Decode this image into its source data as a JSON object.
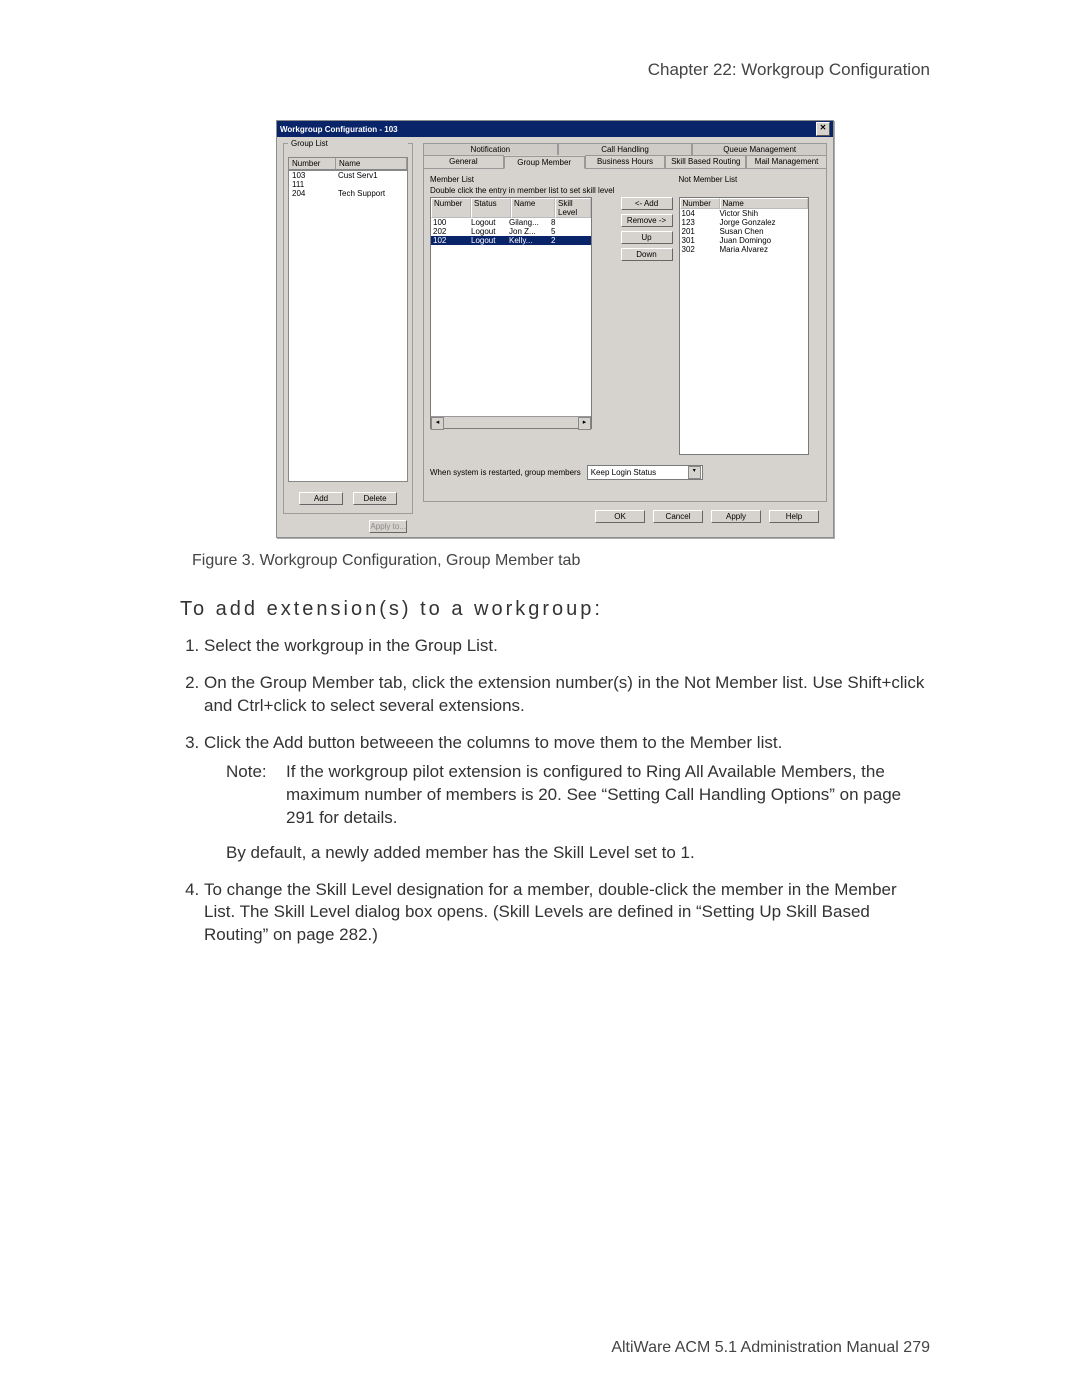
{
  "page": {
    "chapter_header": "Chapter 22:  Workgroup Configuration",
    "figure_caption": "Figure 3.   Workgroup Configuration, Group Member tab",
    "section_heading": "To add extension(s) to a workgroup:",
    "step1": "Select the workgroup in the Group List.",
    "step2": "On the Group Member tab, click the extension number(s) in the Not Member list. Use Shift+click and Ctrl+click to select several extensions.",
    "step3": "Click the Add button betweeen the columns to move them to the Member list.",
    "note_label": "Note:",
    "note_body": "If the workgroup pilot extension is configured to Ring All Available Members, the maximum number of members is 20. See “Setting Call Handling Options” on page 291 for details.",
    "default_line": "By default, a newly added member has the Skill Level set to 1.",
    "step4": "To change the Skill Level designation for a member, double-click the member in the Member List. The Skill Level dialog box opens. (Skill Levels are defined in “Setting Up Skill Based Routing” on page 282.)",
    "footer": "AltiWare ACM 5.1 Administration Manual   279"
  },
  "dialog": {
    "title": "Workgroup Configuration - 103",
    "close_glyph": "✕",
    "group_list_legend": "Group List",
    "gl_headers": {
      "number": "Number",
      "name": "Name"
    },
    "gl_rows": [
      {
        "number": "103",
        "name": "Cust Serv1"
      },
      {
        "number": "111",
        "name": ""
      },
      {
        "number": "204",
        "name": "Tech Support"
      }
    ],
    "btn_add": "Add",
    "btn_delete": "Delete",
    "btn_applyto": "Apply to...",
    "tabs_back": [
      "Notification",
      "Call Handling",
      "Queue Management"
    ],
    "tabs_front": [
      "General",
      "Group Member",
      "Business Hours",
      "Skill Based Routing",
      "Mail Management"
    ],
    "active_tab": "Group Member",
    "member_list_label": "Member List",
    "member_list_hint": "Double click the entry in member list to set skill level",
    "member_headers": {
      "number": "Number",
      "status": "Status",
      "name": "Name",
      "skill": "Skill Level"
    },
    "member_rows": [
      {
        "number": "100",
        "status": "Logout",
        "name": "Gilang...",
        "skill": "8",
        "selected": false
      },
      {
        "number": "202",
        "status": "Logout",
        "name": "Jon Z...",
        "skill": "5",
        "selected": false
      },
      {
        "number": "102",
        "status": "Logout",
        "name": "Kelly...",
        "skill": "2",
        "selected": true
      }
    ],
    "not_member_label": "Not Member List",
    "nm_headers": {
      "number": "Number",
      "name": "Name"
    },
    "nm_rows": [
      {
        "number": "104",
        "name": "Victor Shih"
      },
      {
        "number": "123",
        "name": "Jorge Gonzalez"
      },
      {
        "number": "201",
        "name": "Susan Chen"
      },
      {
        "number": "301",
        "name": "Juan Domingo"
      },
      {
        "number": "302",
        "name": "Maria Alvarez"
      }
    ],
    "mid_buttons": {
      "add": "<- Add",
      "remove": "Remove ->",
      "up": "Up",
      "down": "Down"
    },
    "restart_label": "When system is restarted, group members",
    "restart_value": "Keep Login Status",
    "footer_buttons": {
      "ok": "OK",
      "cancel": "Cancel",
      "apply": "Apply",
      "help": "Help"
    }
  }
}
